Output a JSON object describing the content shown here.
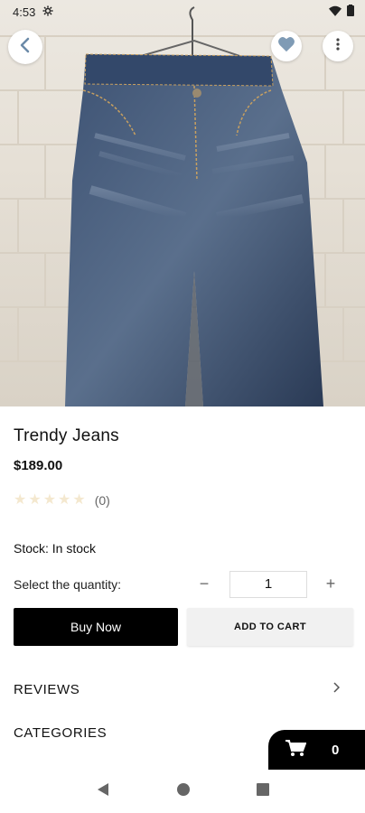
{
  "status_bar": {
    "time": "4:53"
  },
  "product": {
    "name": "Trendy Jeans",
    "price": "$189.00",
    "rating_count": "(0)",
    "rating_value": 0,
    "rating_max": 5,
    "stock": "Stock: In stock"
  },
  "quantity": {
    "label": "Select the quantity:",
    "value": "1",
    "minus": "−",
    "plus": "+"
  },
  "actions": {
    "buy_now": "Buy Now",
    "add_to_cart": "ADD TO CART"
  },
  "sections": {
    "reviews": "REVIEWS",
    "categories": "CATEGORIES"
  },
  "cart": {
    "count": "0"
  },
  "icons": {
    "back": "chevron-left-icon",
    "favorite": "heart-icon",
    "more": "more-vert-icon",
    "cart": "cart-icon"
  },
  "colors": {
    "heart": "#7f9bb5",
    "primary": "#000000",
    "star_empty": "#f4e8cf"
  }
}
